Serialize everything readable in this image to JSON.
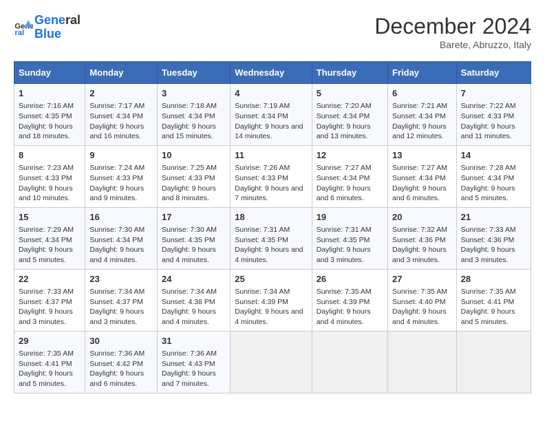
{
  "header": {
    "logo_line1": "General",
    "logo_line2": "Blue",
    "month_title": "December 2024",
    "location": "Barete, Abruzzo, Italy"
  },
  "weekdays": [
    "Sunday",
    "Monday",
    "Tuesday",
    "Wednesday",
    "Thursday",
    "Friday",
    "Saturday"
  ],
  "weeks": [
    [
      {
        "day": 1,
        "sunrise": "7:16 AM",
        "sunset": "4:35 PM",
        "daylight": "9 hours and 18 minutes."
      },
      {
        "day": 2,
        "sunrise": "7:17 AM",
        "sunset": "4:34 PM",
        "daylight": "9 hours and 16 minutes."
      },
      {
        "day": 3,
        "sunrise": "7:18 AM",
        "sunset": "4:34 PM",
        "daylight": "9 hours and 15 minutes."
      },
      {
        "day": 4,
        "sunrise": "7:19 AM",
        "sunset": "4:34 PM",
        "daylight": "9 hours and 14 minutes."
      },
      {
        "day": 5,
        "sunrise": "7:20 AM",
        "sunset": "4:34 PM",
        "daylight": "9 hours and 13 minutes."
      },
      {
        "day": 6,
        "sunrise": "7:21 AM",
        "sunset": "4:34 PM",
        "daylight": "9 hours and 12 minutes."
      },
      {
        "day": 7,
        "sunrise": "7:22 AM",
        "sunset": "4:33 PM",
        "daylight": "9 hours and 11 minutes."
      }
    ],
    [
      {
        "day": 8,
        "sunrise": "7:23 AM",
        "sunset": "4:33 PM",
        "daylight": "9 hours and 10 minutes."
      },
      {
        "day": 9,
        "sunrise": "7:24 AM",
        "sunset": "4:33 PM",
        "daylight": "9 hours and 9 minutes."
      },
      {
        "day": 10,
        "sunrise": "7:25 AM",
        "sunset": "4:33 PM",
        "daylight": "9 hours and 8 minutes."
      },
      {
        "day": 11,
        "sunrise": "7:26 AM",
        "sunset": "4:33 PM",
        "daylight": "9 hours and 7 minutes."
      },
      {
        "day": 12,
        "sunrise": "7:27 AM",
        "sunset": "4:34 PM",
        "daylight": "9 hours and 6 minutes."
      },
      {
        "day": 13,
        "sunrise": "7:27 AM",
        "sunset": "4:34 PM",
        "daylight": "9 hours and 6 minutes."
      },
      {
        "day": 14,
        "sunrise": "7:28 AM",
        "sunset": "4:34 PM",
        "daylight": "9 hours and 5 minutes."
      }
    ],
    [
      {
        "day": 15,
        "sunrise": "7:29 AM",
        "sunset": "4:34 PM",
        "daylight": "9 hours and 5 minutes."
      },
      {
        "day": 16,
        "sunrise": "7:30 AM",
        "sunset": "4:34 PM",
        "daylight": "9 hours and 4 minutes."
      },
      {
        "day": 17,
        "sunrise": "7:30 AM",
        "sunset": "4:35 PM",
        "daylight": "9 hours and 4 minutes."
      },
      {
        "day": 18,
        "sunrise": "7:31 AM",
        "sunset": "4:35 PM",
        "daylight": "9 hours and 4 minutes."
      },
      {
        "day": 19,
        "sunrise": "7:31 AM",
        "sunset": "4:35 PM",
        "daylight": "9 hours and 3 minutes."
      },
      {
        "day": 20,
        "sunrise": "7:32 AM",
        "sunset": "4:36 PM",
        "daylight": "9 hours and 3 minutes."
      },
      {
        "day": 21,
        "sunrise": "7:33 AM",
        "sunset": "4:36 PM",
        "daylight": "9 hours and 3 minutes."
      }
    ],
    [
      {
        "day": 22,
        "sunrise": "7:33 AM",
        "sunset": "4:37 PM",
        "daylight": "9 hours and 3 minutes."
      },
      {
        "day": 23,
        "sunrise": "7:34 AM",
        "sunset": "4:37 PM",
        "daylight": "9 hours and 3 minutes."
      },
      {
        "day": 24,
        "sunrise": "7:34 AM",
        "sunset": "4:38 PM",
        "daylight": "9 hours and 4 minutes."
      },
      {
        "day": 25,
        "sunrise": "7:34 AM",
        "sunset": "4:39 PM",
        "daylight": "9 hours and 4 minutes."
      },
      {
        "day": 26,
        "sunrise": "7:35 AM",
        "sunset": "4:39 PM",
        "daylight": "9 hours and 4 minutes."
      },
      {
        "day": 27,
        "sunrise": "7:35 AM",
        "sunset": "4:40 PM",
        "daylight": "9 hours and 4 minutes."
      },
      {
        "day": 28,
        "sunrise": "7:35 AM",
        "sunset": "4:41 PM",
        "daylight": "9 hours and 5 minutes."
      }
    ],
    [
      {
        "day": 29,
        "sunrise": "7:35 AM",
        "sunset": "4:41 PM",
        "daylight": "9 hours and 5 minutes."
      },
      {
        "day": 30,
        "sunrise": "7:36 AM",
        "sunset": "4:42 PM",
        "daylight": "9 hours and 6 minutes."
      },
      {
        "day": 31,
        "sunrise": "7:36 AM",
        "sunset": "4:43 PM",
        "daylight": "9 hours and 7 minutes."
      },
      null,
      null,
      null,
      null
    ]
  ]
}
